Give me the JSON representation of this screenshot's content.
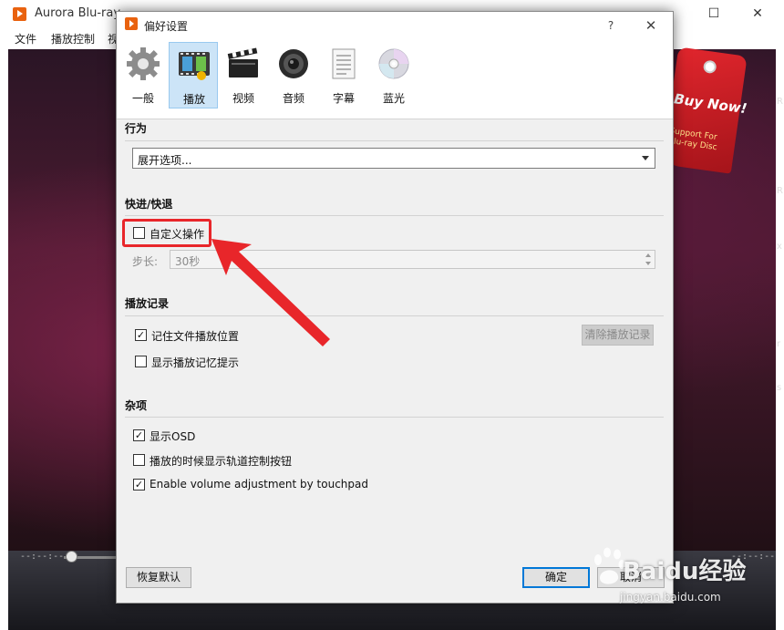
{
  "app": {
    "title": "Aurora Blu-ray",
    "menu": [
      "文件",
      "播放控制",
      "视"
    ],
    "time_left": "--:--:--",
    "time_right": "--:--:--",
    "promo_big": "Buy Now!",
    "promo_small_1": "Support For",
    "promo_small_2": "Blu-ray Disc",
    "edge_letters": [
      "R",
      "R",
      "x",
      "r",
      "s"
    ]
  },
  "dialog": {
    "title": "偏好设置",
    "help": "?",
    "close": "✕",
    "tabs": [
      {
        "label": "一般",
        "icon": "gear-icon"
      },
      {
        "label": "播放",
        "icon": "film-strip-icon",
        "active": true
      },
      {
        "label": "视频",
        "icon": "clapperboard-icon"
      },
      {
        "label": "音频",
        "icon": "speaker-icon"
      },
      {
        "label": "字幕",
        "icon": "document-icon"
      },
      {
        "label": "蓝光",
        "icon": "disc-icon"
      }
    ],
    "behavior": {
      "title": "行为",
      "combo_value": "展开选项..."
    },
    "seek": {
      "title": "快进/快退",
      "custom_label": "自定义操作",
      "custom_checked": false,
      "step_label": "步长:",
      "step_value": "30秒"
    },
    "history": {
      "title": "播放记录",
      "remember_label": "记住文件播放位置",
      "remember_checked": true,
      "show_hint_label": "显示播放记忆提示",
      "show_hint_checked": false,
      "clear_button": "清除播放记录"
    },
    "misc": {
      "title": "杂项",
      "osd_label": "显示OSD",
      "osd_checked": true,
      "track_label": "播放的时候显示轨道控制按钮",
      "track_checked": false,
      "touchpad_label": "Enable volume adjustment by touchpad",
      "touchpad_checked": true
    },
    "buttons": {
      "restore": "恢复默认",
      "ok": "确定",
      "cancel": "取消"
    }
  },
  "watermark": {
    "text": "Baidu经验",
    "sub": "jingyan.baidu.com"
  },
  "colors": {
    "accent": "#0078d7",
    "annotation_red": "#e8262a",
    "brand_orange": "#e9620f"
  }
}
